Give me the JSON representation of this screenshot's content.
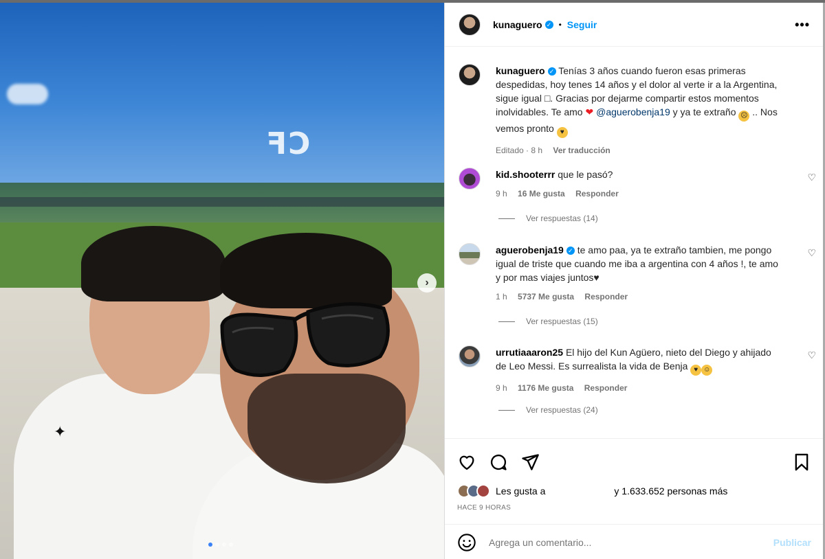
{
  "header": {
    "username": "kunaguero",
    "separator": "•",
    "follow_label": "Seguir",
    "more_label": "•••"
  },
  "caption": {
    "username": "kunaguero",
    "text_1": "Tenías 3 años cuando fueron esas primeras despedidas, hoy tenes 14 años y el dolor al verte ir a la Argentina, sigue igual □. Gracias por dejarme compartir estos momentos inolvidables. Te amo",
    "mention": "@aguerobenja19",
    "text_2": "y ya te extraño",
    "text_3": ".. Nos vemos pronto",
    "edited": "Editado · 8 h",
    "translate": "Ver traducción"
  },
  "comments": [
    {
      "username": "kid.shooterrr",
      "text": "que le pasó?",
      "time": "9 h",
      "likes": "16 Me gusta",
      "reply": "Responder",
      "replies": "Ver respuestas (14)"
    },
    {
      "username": "aguerobenja19",
      "text": "te amo paa, ya te extraño tambien, me pongo igual de triste que cuando me iba a argentina con 4 años !, te amo y por mas viajes juntos♥",
      "time": "1 h",
      "likes": "5737 Me gusta",
      "reply": "Responder",
      "replies": "Ver respuestas (15)"
    },
    {
      "username": "urrutiaaaron25",
      "text": "El hijo del Kun Agüero, nieto del Diego y ahijado de Leo Messi. Es surrealista la vida de Benja",
      "time": "9 h",
      "likes": "1176 Me gusta",
      "reply": "Responder",
      "replies": "Ver respuestas (24)"
    }
  ],
  "likes": {
    "prefix": "Les gusta a",
    "suffix": "y 1.633.652 personas más"
  },
  "timestamp": "HACE 9 HORAS",
  "comment_box": {
    "placeholder": "Agrega un comentario...",
    "post_label": "Publicar"
  },
  "media": {
    "reflection_text": "CF",
    "carousel_count": 4,
    "carousel_active": 1
  },
  "colors": {
    "accent": "#0095f6",
    "heart": "#ed1d24"
  }
}
